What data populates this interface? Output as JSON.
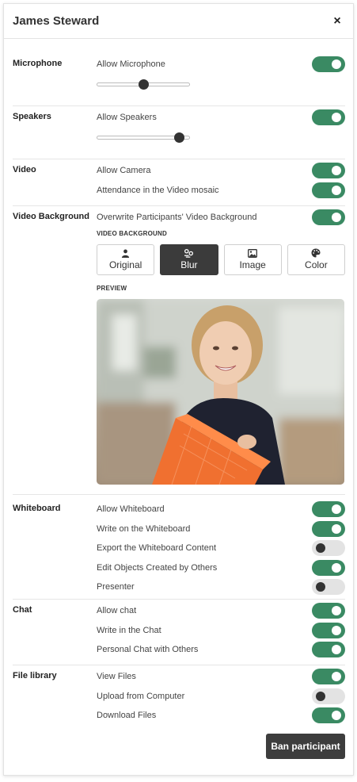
{
  "header": {
    "title": "James Steward",
    "close_glyph": "×"
  },
  "microphone": {
    "label": "Microphone",
    "allow_label": "Allow Microphone",
    "allow_on": true,
    "volume": 0.5
  },
  "speakers": {
    "label": "Speakers",
    "allow_label": "Allow Speakers",
    "allow_on": true,
    "volume": 0.93
  },
  "video": {
    "label": "Video",
    "items": [
      {
        "label": "Allow Camera",
        "on": true
      },
      {
        "label": "Attendance in the Video mosaic",
        "on": true
      }
    ]
  },
  "video_background": {
    "label": "Video Background",
    "overwrite_label": "Overwrite Participants' Video Background",
    "overwrite_on": true,
    "sub_heading": "VIDEO BACKGROUND",
    "options": [
      {
        "label": "Original",
        "icon": "person-icon",
        "active": false
      },
      {
        "label": "Blur",
        "icon": "blur-icon",
        "active": true
      },
      {
        "label": "Image",
        "icon": "image-icon",
        "active": false
      },
      {
        "label": "Color",
        "icon": "palette-icon",
        "active": false
      }
    ],
    "preview_heading": "PREVIEW"
  },
  "whiteboard": {
    "label": "Whiteboard",
    "items": [
      {
        "label": "Allow Whiteboard",
        "on": true
      },
      {
        "label": "Write on the Whiteboard",
        "on": true
      },
      {
        "label": "Export the Whiteboard Content",
        "on": false
      },
      {
        "label": "Edit Objects Created by Others",
        "on": true
      },
      {
        "label": "Presenter",
        "on": false
      }
    ]
  },
  "chat": {
    "label": "Chat",
    "items": [
      {
        "label": "Allow chat",
        "on": true
      },
      {
        "label": "Write in the Chat",
        "on": true
      },
      {
        "label": "Personal Chat with Others",
        "on": true
      }
    ]
  },
  "file_library": {
    "label": "File library",
    "items": [
      {
        "label": "View Files",
        "on": true
      },
      {
        "label": "Upload from Computer",
        "on": false
      },
      {
        "label": "Download Files",
        "on": true
      }
    ]
  },
  "footer": {
    "ban_label": "Ban participant"
  },
  "colors": {
    "accent": "#3a8a63",
    "toggle_off": "#e3e3e3",
    "dark_button": "#3d3d3d"
  }
}
